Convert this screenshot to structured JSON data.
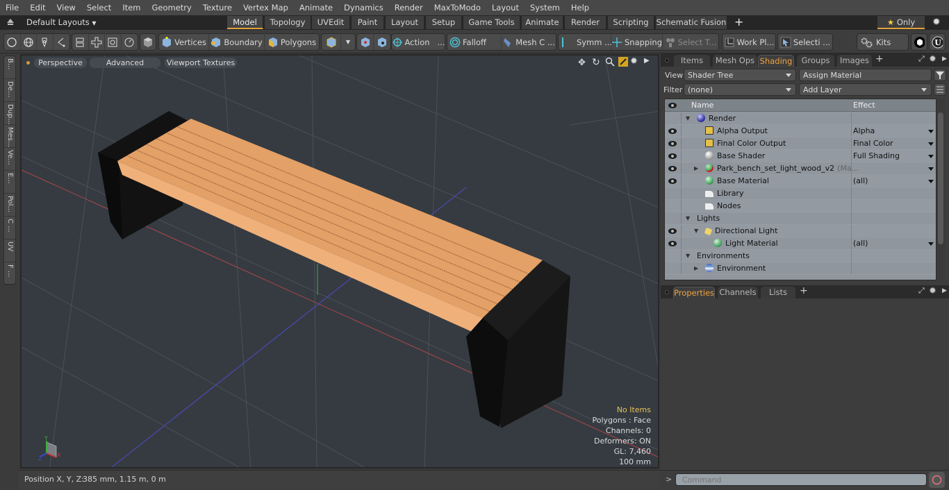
{
  "menubar": {
    "items": [
      "File",
      "Edit",
      "View",
      "Select",
      "Item",
      "Geometry",
      "Texture",
      "Vertex Map",
      "Animate",
      "Dynamics",
      "Render",
      "MaxToModo",
      "Layout",
      "System",
      "Help"
    ]
  },
  "layoutbar": {
    "layouts_label": "Default Layouts",
    "tabs": [
      "Model",
      "Topology",
      "UVEdit",
      "Paint",
      "Layout",
      "Setup",
      "Game Tools",
      "Animate",
      "Render",
      "Scripting",
      "Schematic Fusion"
    ],
    "active_tab": "Model",
    "add_label": "+",
    "only_label": "Only"
  },
  "toolbar": {
    "vertices": "Vertices",
    "boundary": "Boundary",
    "polygons": "Polygons",
    "action": "Action",
    "action_more": "...",
    "falloff": "Falloff",
    "mesh_constraints": "Mesh C ...",
    "symmetry": "Symm ...",
    "snapping": "Snapping",
    "select_through": "Select T...",
    "work_plane": "Work Pl...",
    "selection": "Selecti ...",
    "kits": "Kits"
  },
  "leftstrip": {
    "tabs": [
      "B...",
      "De...",
      "Dup...",
      "Mes...",
      "Ve...",
      "E...",
      "Pol...",
      "C ...",
      "UV",
      "F ..."
    ]
  },
  "viewport": {
    "view_mode": "Perspective",
    "shading": "Advanced",
    "textures": "Viewport Textures",
    "info": {
      "items": "No Items",
      "polygons": "Polygons : Face",
      "channels": "Channels: 0",
      "deformers": "Deformers: ON",
      "gl": "GL: 7,460",
      "scale": "100 mm"
    },
    "axis_labels": {
      "x": "X",
      "y": "Y",
      "z": "Z"
    },
    "info_highlight_color": "#e8c25a"
  },
  "statusbar": {
    "position_label": "Position X, Y, Z:",
    "position_value": "385 mm, 1.15 m, 0 m"
  },
  "rightpanel": {
    "tabs": [
      "Items",
      "Mesh Ops",
      "Shading",
      "Groups",
      "Images"
    ],
    "active_tab": "Shading",
    "add_label": "+",
    "view_label": "View",
    "view_value": "Shader Tree",
    "assign_material": "Assign Material",
    "filter_label": "Filter",
    "filter_value": "(none)",
    "add_layer": "Add Layer",
    "tree": {
      "headers": {
        "name": "Name",
        "effect": "Effect"
      },
      "rows": [
        {
          "name": "Render",
          "effect": "",
          "eye": false,
          "icon": "render-sphere-icon"
        },
        {
          "name": "Alpha Output",
          "effect": "Alpha",
          "eye": true,
          "icon": "render-output-icon"
        },
        {
          "name": "Final Color Output",
          "effect": "Final Color",
          "eye": true,
          "icon": "render-output-icon"
        },
        {
          "name": "Base Shader",
          "effect": "Full Shading",
          "eye": true,
          "icon": "shader-sphere-icon"
        },
        {
          "name": "Park_bench_set_light_wood_v2",
          "suffix": "(Ma...",
          "effect": "",
          "eye": true,
          "icon": "material-group-icon"
        },
        {
          "name": "Base Material",
          "effect": "(all)",
          "eye": true,
          "icon": "material-sphere-icon"
        },
        {
          "name": "Library",
          "effect": "",
          "eye": false,
          "icon": "folder-icon"
        },
        {
          "name": "Nodes",
          "effect": "",
          "eye": false,
          "icon": "folder-icon"
        },
        {
          "name": "Lights",
          "effect": "",
          "eye": false,
          "icon": ""
        },
        {
          "name": "Directional Light",
          "effect": "",
          "eye": true,
          "icon": "directional-light-icon"
        },
        {
          "name": "Light Material",
          "effect": "(all)",
          "eye": true,
          "icon": "material-sphere-icon"
        },
        {
          "name": "Environments",
          "effect": "",
          "eye": false,
          "icon": ""
        },
        {
          "name": "Environment",
          "effect": "",
          "eye": false,
          "icon": "environment-sphere-icon"
        }
      ]
    },
    "lower_tabs": [
      "Properties",
      "Channels",
      "Lists"
    ],
    "lower_active_tab": "Properties",
    "command_prompt": ">",
    "command_placeholder": "Command"
  },
  "colors": {
    "accent": "#e3a33b",
    "active_tab_text": "#f0a33d",
    "viewport_bg": "#353b41",
    "tree_bg": "#8f969e",
    "wood": "#e8a265",
    "bench_leg": "#1a1a1a"
  }
}
